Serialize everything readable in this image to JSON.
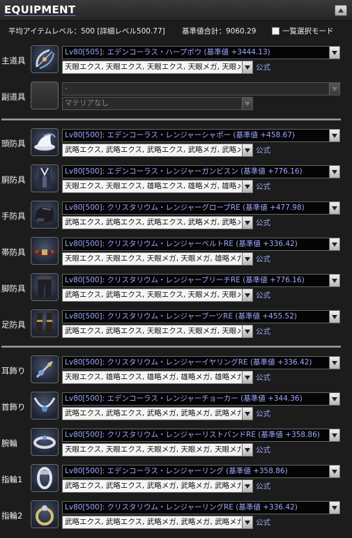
{
  "header": {
    "title": "EQUIPMENT",
    "collapse_label": "▲"
  },
  "summary": {
    "avg_level": "平均アイテムレベル：500 [詳細レベル500.77]",
    "total_base": "基準値合計：9060.29",
    "bulk_select_label": "一覧選択モード"
  },
  "official_label": "公式",
  "slots": [
    {
      "label": "主道具",
      "icon": "harp-bow-icon",
      "item": "Lv80[505]: エデンコーラス・ハープボウ (基準値 +3444.13)",
      "materia": "天眼エクス, 天眼エクス, 天眼エクス, 天眼メガ, 天眼メガ"
    },
    {
      "label": "副道具",
      "icon": "empty-slot-icon",
      "item": "-",
      "materia": "マテリアなし"
    },
    {
      "label": "頭防具",
      "icon": "hat-icon",
      "item": "Lv80[500]: エデンコーラス・レンジャーシャポー (基準値 +458.67)",
      "materia": "武略エクス, 武略エクス, 武略エクス, 武略メガ, 武略メガ"
    },
    {
      "label": "胴防具",
      "icon": "body-armor-icon",
      "item": "Lv80[500]: エデンコーラス・レンジャーガンビスン (基準値 +776.16)",
      "materia": "天眼エクス, 天眼エクス, 雄略エクス, 雄略メガ, 雄略メガ"
    },
    {
      "label": "手防具",
      "icon": "gloves-icon",
      "item": "Lv80[500]: クリスタリウム・レンジャーグローブRE (基準値 +477.98)",
      "materia": "武略エクス, 武略エクス, 武略エクス, 武略メガ, 武略メガ"
    },
    {
      "label": "帯防具",
      "icon": "belt-icon",
      "item": "Lv80[500]: クリスタリウム・レンジャーベルトRE (基準値 +336.42)",
      "materia": "天眼エクス, 天眼エクス, 天眼メガ, 天眼メガ, 雄略メガ"
    },
    {
      "label": "脚防具",
      "icon": "breeches-icon",
      "item": "Lv80[500]: クリスタリウム・レンジャーブリーチRE (基準値 +776.16)",
      "materia": "武略エクス, 武略エクス, 天眼エクス, 天眼メガ, 天眼メガ"
    },
    {
      "label": "足防具",
      "icon": "boots-icon",
      "item": "Lv80[500]: クリスタリウム・レンジャーブーツRE (基準値 +455.52)",
      "materia": "武略エクス, 武略エクス, 天眼エクス, 天眼メガ, 天眼メガ"
    },
    {
      "label": "耳飾り",
      "icon": "earring-icon",
      "item": "Lv80[500]: クリスタリウム・レンジャーイヤリングRE (基準値 +336.42)",
      "materia": "天眼エクス, 雄略エクス, 雄略メガ, 雄略メガ, 雄略メガ"
    },
    {
      "label": "首飾り",
      "icon": "necklace-icon",
      "item": "Lv80[500]: エデンコーラス・レンジャーチョーカー (基準値 +344.36)",
      "materia": "武略エクス, 武略エクス, 武略メガ, 武略メガ, 武略メガ"
    },
    {
      "label": "腕輪",
      "icon": "bracelet-icon",
      "item": "Lv80[500]: クリスタリウム・レンジャーリストバンドRE (基準値 +358.86)",
      "materia": "天眼エクス, 天眼エクス, 天眼メガ, 天眼メガ, 天眼メガ"
    },
    {
      "label": "指輪1",
      "icon": "ring-icon",
      "item": "Lv80[500]: エデンコーラス・レンジャーリング (基準値 +358.86)",
      "materia": "武略エクス, 武略エクス, 武略メガ, 武略メガ, 武略メガ"
    },
    {
      "label": "指輪2",
      "icon": "ring-icon",
      "item": "Lv80[500]: クリスタリウム・レンジャーリングRE (基準値 +336.42)",
      "materia": "武略エクス, 武略エクス, 武略メガ, 武略メガ, 武略メガ"
    }
  ]
}
